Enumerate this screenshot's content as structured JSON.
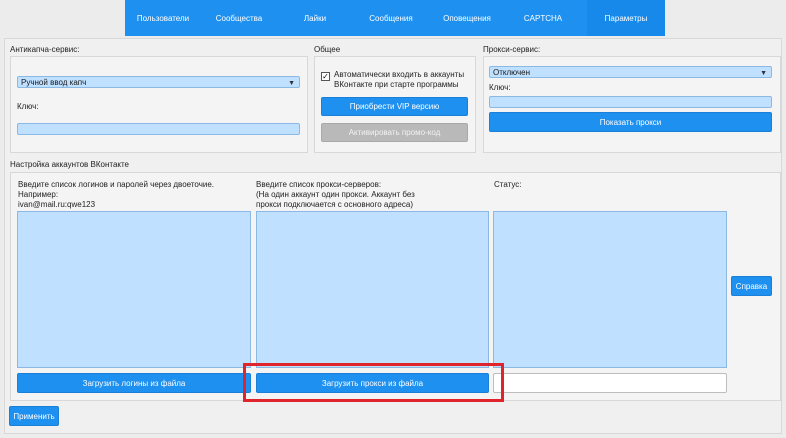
{
  "nav": {
    "tabs": [
      {
        "label": "Пользователи"
      },
      {
        "label": "Сообщества"
      },
      {
        "label": "Лайки"
      },
      {
        "label": "Сообщения"
      },
      {
        "label": "Оповещения"
      },
      {
        "label": "CAPTCHA"
      },
      {
        "label": "Параметры"
      }
    ]
  },
  "anticaptcha": {
    "title": "Антикапча-сервис:",
    "service_value": "Ручной ввод капч",
    "key_label": "Ключ:",
    "key_value": ""
  },
  "general": {
    "title": "Общее",
    "autologin_label": "Автоматически входить в аккаунты\nВКонтакте при старте программы",
    "autologin_mark": "✓",
    "vip_button": "Приобрести VIP версию",
    "promo_button": "Активировать промо-код"
  },
  "proxy_service": {
    "title": "Прокси-сервис:",
    "service_value": "Отключен",
    "key_label": "Ключ:",
    "key_value": "",
    "show_button": "Показать прокси"
  },
  "accounts": {
    "title": "Настройка аккаунтов ВКонтакте",
    "logins_label": "Введите список логинов и паролей через двоеточие.\nНапример:\nivan@mail.ru:qwe123",
    "proxies_label": "Введите список прокси-серверов:\n(На один аккаунт один прокси. Аккаунт без\nпрокси подключается с основного адреса)",
    "status_label": "Статус:",
    "logins_value": "",
    "proxies_value": "",
    "status_value": "",
    "load_logins_button": "Загрузить логины из файла",
    "load_proxies_button": "Загрузить прокси из файла",
    "help_button": "Справка"
  },
  "footer": {
    "apply_button": "Применить"
  },
  "colors": {
    "accent": "#1e90f0",
    "highlight": "#e0242c"
  }
}
